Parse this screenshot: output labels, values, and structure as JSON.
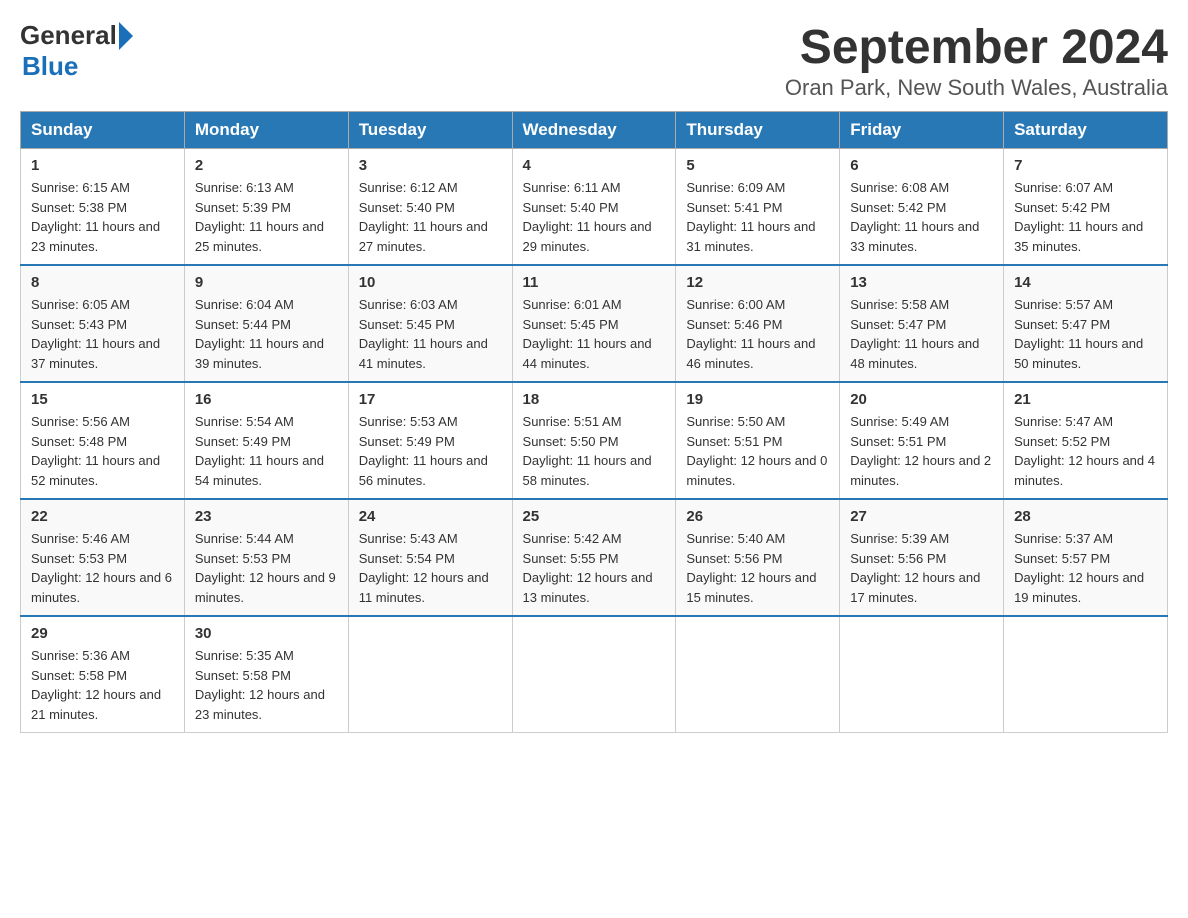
{
  "logo": {
    "text_general": "General",
    "text_blue": "Blue",
    "triangle": "▶"
  },
  "title": "September 2024",
  "location": "Oran Park, New South Wales, Australia",
  "days_of_week": [
    "Sunday",
    "Monday",
    "Tuesday",
    "Wednesday",
    "Thursday",
    "Friday",
    "Saturday"
  ],
  "weeks": [
    [
      {
        "day": "1",
        "sunrise": "6:15 AM",
        "sunset": "5:38 PM",
        "daylight": "11 hours and 23 minutes."
      },
      {
        "day": "2",
        "sunrise": "6:13 AM",
        "sunset": "5:39 PM",
        "daylight": "11 hours and 25 minutes."
      },
      {
        "day": "3",
        "sunrise": "6:12 AM",
        "sunset": "5:40 PM",
        "daylight": "11 hours and 27 minutes."
      },
      {
        "day": "4",
        "sunrise": "6:11 AM",
        "sunset": "5:40 PM",
        "daylight": "11 hours and 29 minutes."
      },
      {
        "day": "5",
        "sunrise": "6:09 AM",
        "sunset": "5:41 PM",
        "daylight": "11 hours and 31 minutes."
      },
      {
        "day": "6",
        "sunrise": "6:08 AM",
        "sunset": "5:42 PM",
        "daylight": "11 hours and 33 minutes."
      },
      {
        "day": "7",
        "sunrise": "6:07 AM",
        "sunset": "5:42 PM",
        "daylight": "11 hours and 35 minutes."
      }
    ],
    [
      {
        "day": "8",
        "sunrise": "6:05 AM",
        "sunset": "5:43 PM",
        "daylight": "11 hours and 37 minutes."
      },
      {
        "day": "9",
        "sunrise": "6:04 AM",
        "sunset": "5:44 PM",
        "daylight": "11 hours and 39 minutes."
      },
      {
        "day": "10",
        "sunrise": "6:03 AM",
        "sunset": "5:45 PM",
        "daylight": "11 hours and 41 minutes."
      },
      {
        "day": "11",
        "sunrise": "6:01 AM",
        "sunset": "5:45 PM",
        "daylight": "11 hours and 44 minutes."
      },
      {
        "day": "12",
        "sunrise": "6:00 AM",
        "sunset": "5:46 PM",
        "daylight": "11 hours and 46 minutes."
      },
      {
        "day": "13",
        "sunrise": "5:58 AM",
        "sunset": "5:47 PM",
        "daylight": "11 hours and 48 minutes."
      },
      {
        "day": "14",
        "sunrise": "5:57 AM",
        "sunset": "5:47 PM",
        "daylight": "11 hours and 50 minutes."
      }
    ],
    [
      {
        "day": "15",
        "sunrise": "5:56 AM",
        "sunset": "5:48 PM",
        "daylight": "11 hours and 52 minutes."
      },
      {
        "day": "16",
        "sunrise": "5:54 AM",
        "sunset": "5:49 PM",
        "daylight": "11 hours and 54 minutes."
      },
      {
        "day": "17",
        "sunrise": "5:53 AM",
        "sunset": "5:49 PM",
        "daylight": "11 hours and 56 minutes."
      },
      {
        "day": "18",
        "sunrise": "5:51 AM",
        "sunset": "5:50 PM",
        "daylight": "11 hours and 58 minutes."
      },
      {
        "day": "19",
        "sunrise": "5:50 AM",
        "sunset": "5:51 PM",
        "daylight": "12 hours and 0 minutes."
      },
      {
        "day": "20",
        "sunrise": "5:49 AM",
        "sunset": "5:51 PM",
        "daylight": "12 hours and 2 minutes."
      },
      {
        "day": "21",
        "sunrise": "5:47 AM",
        "sunset": "5:52 PM",
        "daylight": "12 hours and 4 minutes."
      }
    ],
    [
      {
        "day": "22",
        "sunrise": "5:46 AM",
        "sunset": "5:53 PM",
        "daylight": "12 hours and 6 minutes."
      },
      {
        "day": "23",
        "sunrise": "5:44 AM",
        "sunset": "5:53 PM",
        "daylight": "12 hours and 9 minutes."
      },
      {
        "day": "24",
        "sunrise": "5:43 AM",
        "sunset": "5:54 PM",
        "daylight": "12 hours and 11 minutes."
      },
      {
        "day": "25",
        "sunrise": "5:42 AM",
        "sunset": "5:55 PM",
        "daylight": "12 hours and 13 minutes."
      },
      {
        "day": "26",
        "sunrise": "5:40 AM",
        "sunset": "5:56 PM",
        "daylight": "12 hours and 15 minutes."
      },
      {
        "day": "27",
        "sunrise": "5:39 AM",
        "sunset": "5:56 PM",
        "daylight": "12 hours and 17 minutes."
      },
      {
        "day": "28",
        "sunrise": "5:37 AM",
        "sunset": "5:57 PM",
        "daylight": "12 hours and 19 minutes."
      }
    ],
    [
      {
        "day": "29",
        "sunrise": "5:36 AM",
        "sunset": "5:58 PM",
        "daylight": "12 hours and 21 minutes."
      },
      {
        "day": "30",
        "sunrise": "5:35 AM",
        "sunset": "5:58 PM",
        "daylight": "12 hours and 23 minutes."
      },
      null,
      null,
      null,
      null,
      null
    ]
  ]
}
